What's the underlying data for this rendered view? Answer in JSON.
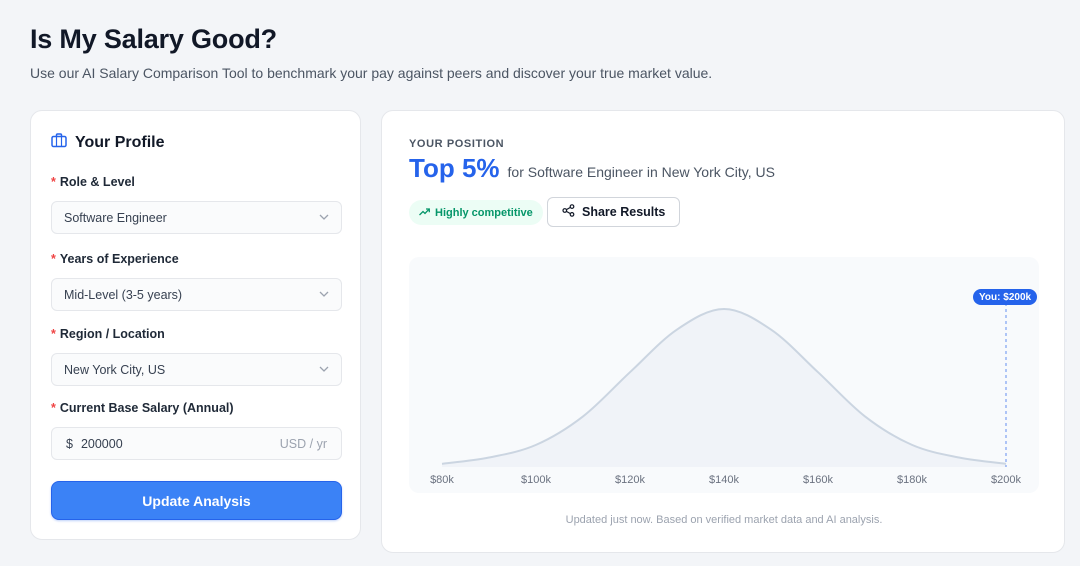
{
  "header": {
    "title": "Is My Salary Good?",
    "subtitle": "Use our AI Salary Comparison Tool to benchmark your pay against peers and discover your true market value."
  },
  "profile": {
    "heading": "Your Profile",
    "heading_icon": "briefcase-icon",
    "required_marker": "*",
    "role": {
      "label": "Role & Level",
      "value": "Software Engineer"
    },
    "experience": {
      "label": "Years of Experience",
      "value": "Mid-Level (3-5 years)"
    },
    "region": {
      "label": "Region / Location",
      "value": "New York City, US"
    },
    "salary": {
      "label": "Current Base Salary (Annual)",
      "currency": "$",
      "value": "200000",
      "unit": "USD / yr"
    },
    "update_label": "Update Analysis"
  },
  "result": {
    "position_label": "YOUR POSITION",
    "rank": "Top 5%",
    "rank_description": "for Software Engineer in New York City, US",
    "badge": "Highly competitive",
    "badge_icon": "trend-up-icon",
    "share_label": "Share Results",
    "share_icon": "share-icon",
    "you_marker": "You: $200k",
    "footnote": "Updated just now. Based on verified market data and AI analysis."
  },
  "colors": {
    "accent": "#3b82f6",
    "rank_blue": "#2563eb",
    "success": "#059669",
    "required": "#ef4444"
  },
  "chart_data": {
    "type": "area",
    "title": "",
    "xlabel": "",
    "ylabel": "",
    "x_ticks": [
      "$80k",
      "$100k",
      "$120k",
      "$140k",
      "$160k",
      "$180k",
      "$200k"
    ],
    "x_range": [
      80000,
      200000
    ],
    "distribution": {
      "shape": "normal",
      "peak_x": 140000
    },
    "x": [
      80000,
      90000,
      100000,
      110000,
      120000,
      130000,
      140000,
      150000,
      160000,
      170000,
      180000,
      190000,
      200000
    ],
    "y": [
      0.02,
      0.06,
      0.14,
      0.32,
      0.6,
      0.87,
      1.0,
      0.87,
      0.6,
      0.32,
      0.14,
      0.06,
      0.02
    ],
    "marker": {
      "x": 200000,
      "label": "You: $200k"
    },
    "grid": false
  }
}
